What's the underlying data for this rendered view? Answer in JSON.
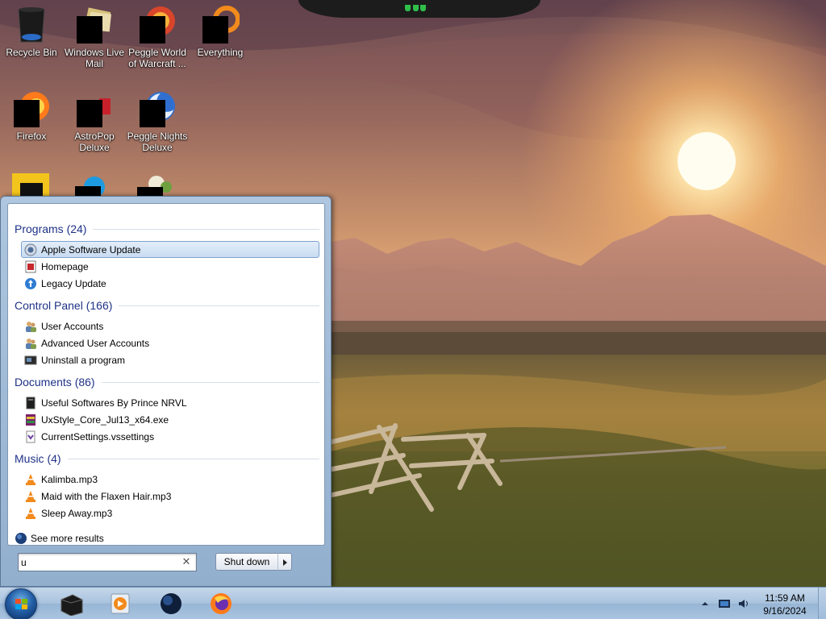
{
  "desktop": {
    "icons": [
      {
        "label": "Recycle Bin"
      },
      {
        "label": "Windows Live Mail"
      },
      {
        "label": "Peggle World of Warcraft ..."
      },
      {
        "label": "Everything"
      },
      {
        "label": "Firefox"
      },
      {
        "label": "AstroPop Deluxe"
      },
      {
        "label": "Peggle Nights Deluxe"
      }
    ]
  },
  "start_menu": {
    "groups": [
      {
        "title": "Programs (24)",
        "items": [
          {
            "label": "Apple Software Update",
            "icon": "apple-update-icon",
            "selected": true
          },
          {
            "label": "Homepage",
            "icon": "homepage-icon"
          },
          {
            "label": "Legacy Update",
            "icon": "legacy-update-icon"
          }
        ]
      },
      {
        "title": "Control Panel (166)",
        "items": [
          {
            "label": "User Accounts",
            "icon": "user-accounts-icon"
          },
          {
            "label": "Advanced User Accounts",
            "icon": "user-accounts-icon"
          },
          {
            "label": "Uninstall a program",
            "icon": "programs-icon"
          }
        ]
      },
      {
        "title": "Documents (86)",
        "items": [
          {
            "label": "Useful Softwares By Prince NRVL",
            "icon": "document-icon"
          },
          {
            "label": "UxStyle_Core_Jul13_x64.exe",
            "icon": "archive-icon"
          },
          {
            "label": "CurrentSettings.vssettings",
            "icon": "vssettings-icon"
          }
        ]
      },
      {
        "title": "Music (4)",
        "items": [
          {
            "label": "Kalimba.mp3",
            "icon": "vlc-icon"
          },
          {
            "label": "Maid with the Flaxen Hair.mp3",
            "icon": "vlc-icon"
          },
          {
            "label": "Sleep Away.mp3",
            "icon": "vlc-icon"
          }
        ]
      }
    ],
    "see_more_label": "See more results",
    "search": {
      "value": "u"
    },
    "shutdown_label": "Shut down"
  },
  "taskbar": {
    "clock_time": "11:59 AM",
    "clock_date": "9/16/2024"
  },
  "colors": {
    "group_header": "#1e3287",
    "selection_border": "#7da2ce"
  }
}
